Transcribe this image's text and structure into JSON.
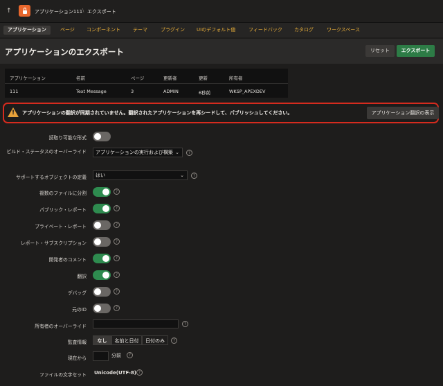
{
  "topbar": {
    "up_glyph": "↑",
    "app_name": "アプリケーション111",
    "separator": "\\",
    "page": "エクスポート"
  },
  "tabs": [
    "アプリケーション",
    "ページ",
    "コンポーネント",
    "テーマ",
    "プラグイン",
    "UIのデフォルト値",
    "フィードバック",
    "カタログ",
    "ワークスペース"
  ],
  "header": {
    "title": "アプリケーションのエクスポート",
    "reset_label": "リセット",
    "export_label": "エクスポート"
  },
  "info": {
    "headers": [
      "アプリケーション",
      "名前",
      "ページ",
      "更新者",
      "更新",
      "所有者"
    ],
    "values": [
      "111",
      "Text Message",
      "3",
      "ADMIN",
      "6秒前",
      "WKSP_APEXDEV"
    ]
  },
  "warning": {
    "text": "アプリケーションの翻訳が同期されていません。翻訳されたアプリケーションを再シードして、パブリッシュしてください。",
    "button": "アプリケーション翻訳の表示"
  },
  "form": {
    "readable": {
      "label": "読取り可能な形式",
      "value": false
    },
    "build_status": {
      "label": "ビルド・ステータスのオーバーライド",
      "value": "アプリケーションの実行および構築"
    },
    "supporting_objects": {
      "label": "サポートするオブジェクトの定義",
      "value": "はい"
    },
    "split_files": {
      "label": "複数のファイルに分割",
      "value": true
    },
    "public_reports": {
      "label": "パブリック・レポート",
      "value": true
    },
    "private_reports": {
      "label": "プライベート・レポート",
      "value": false
    },
    "report_subscriptions": {
      "label": "レポート・サブスクリプション",
      "value": false
    },
    "dev_comments": {
      "label": "開発者のコメント",
      "value": true
    },
    "translations": {
      "label": "翻訳",
      "value": true
    },
    "debug": {
      "label": "デバッグ",
      "value": false
    },
    "original_ids": {
      "label": "元のID",
      "value": false
    },
    "owner_override": {
      "label": "所有者のオーバーライド",
      "value": ""
    },
    "audit": {
      "label": "監査情報",
      "options": [
        "なし",
        "名前と日付",
        "日付のみ"
      ],
      "selected": "なし"
    },
    "as_of": {
      "label": "現在から",
      "value": "",
      "unit": "分前"
    },
    "charset": {
      "label": "ファイルの文字セット",
      "value": "Unicode(UTF-8)"
    }
  },
  "colors": {
    "accent_orange": "#e8672d",
    "tab_text": "#e8ae3a",
    "export_green": "#2d7c46",
    "toggle_on": "#2e8b4f",
    "warning_border": "#d62b1e"
  },
  "icons": {
    "up": "up-arrow-icon",
    "app": "lock-icon",
    "warning": "warning-triangle-icon",
    "help": "help-icon",
    "dropdown": "chevron-down-icon"
  }
}
